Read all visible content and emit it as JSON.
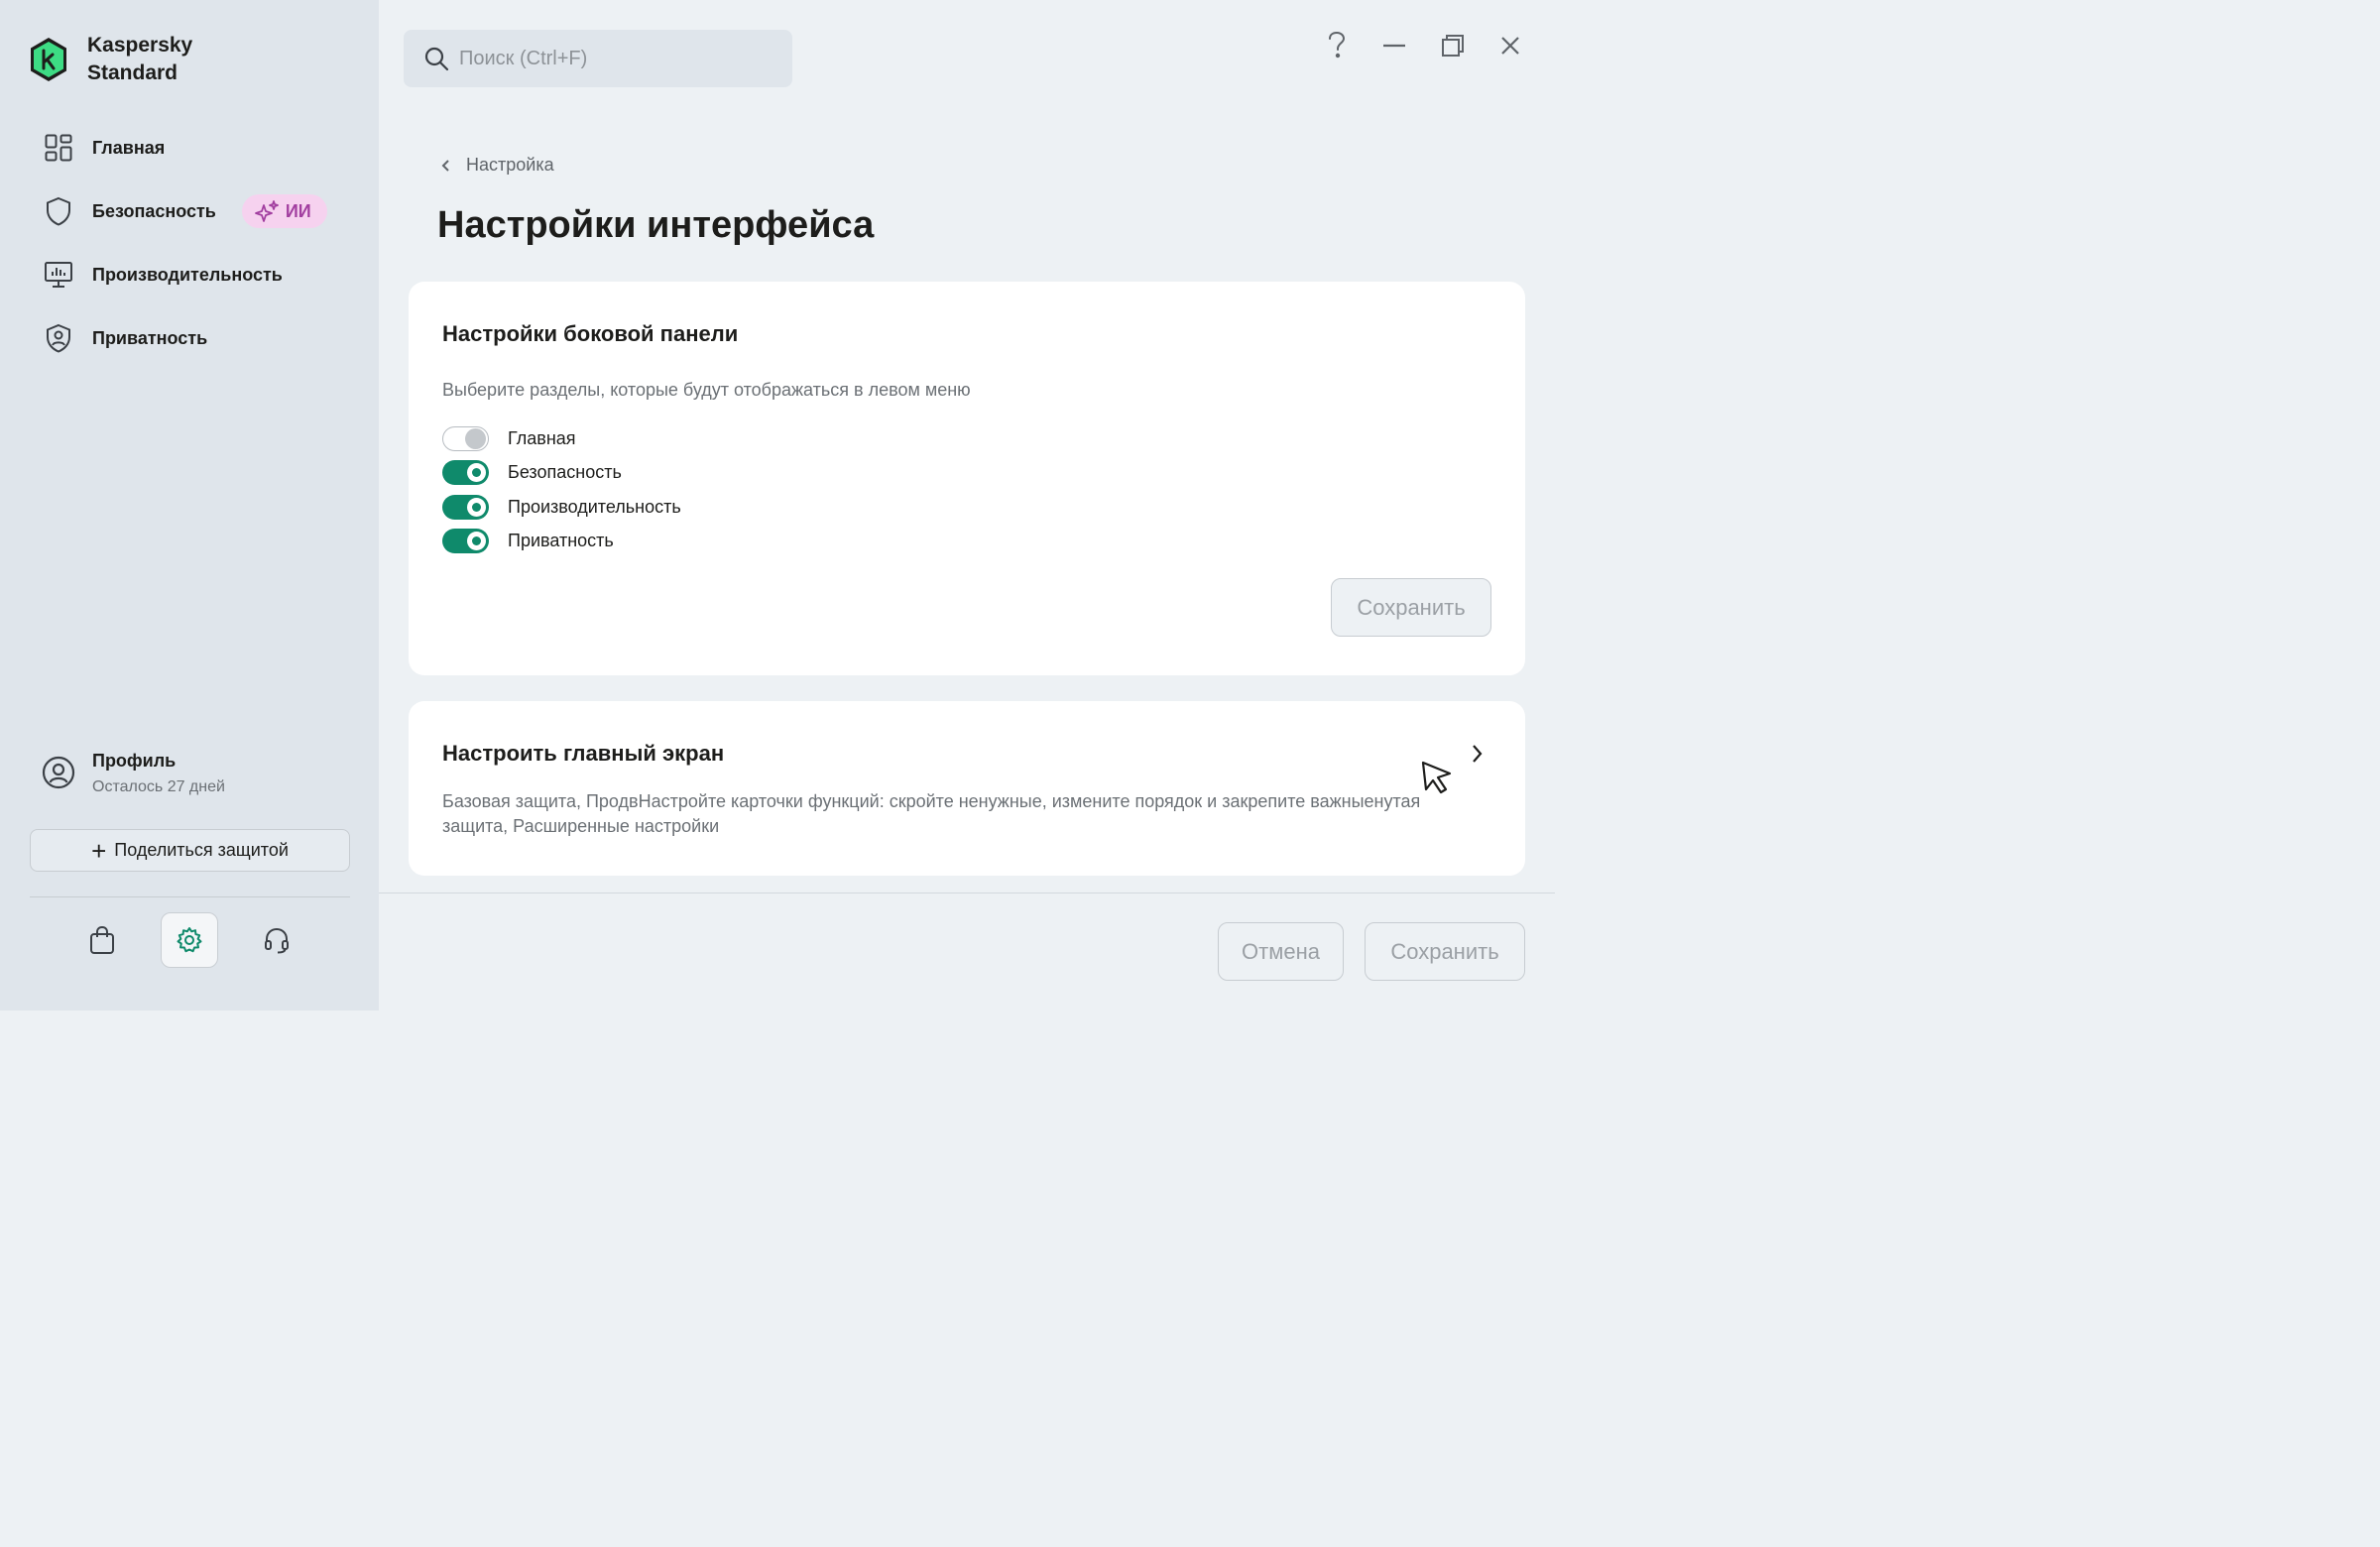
{
  "app": {
    "brand_line1": "Kaspersky",
    "brand_line2": "Standard"
  },
  "sidebar": {
    "items": [
      {
        "label": "Главная",
        "icon": "dashboard-icon"
      },
      {
        "label": "Безопасность",
        "icon": "shield-icon",
        "badge": "ИИ"
      },
      {
        "label": "Производительность",
        "icon": "monitor-chart-icon"
      },
      {
        "label": "Приватность",
        "icon": "privacy-shield-icon"
      }
    ],
    "profile": {
      "name": "Профиль",
      "subtitle": "Осталось 27 дней"
    },
    "share_button": "Поделиться защитой",
    "bottom_icons": [
      "shopping-bag-icon",
      "gear-icon",
      "headset-icon"
    ],
    "active_bottom_icon": "gear-icon"
  },
  "search": {
    "placeholder": "Поиск (Ctrl+F)"
  },
  "window_controls": [
    "help-icon",
    "minimize-icon",
    "restore-icon",
    "close-icon"
  ],
  "breadcrumb": "Настройка",
  "page_title": "Настройки интерфейса",
  "sidebar_settings": {
    "title": "Настройки боковой панели",
    "subtitle": "Выберите разделы, которые будут отображаться в левом меню",
    "toggles": [
      {
        "label": "Главная",
        "on": false
      },
      {
        "label": "Безопасность",
        "on": true
      },
      {
        "label": "Производительность",
        "on": true
      },
      {
        "label": "Приватность",
        "on": true
      }
    ],
    "save_label": "Сохранить"
  },
  "home_screen": {
    "title": "Настроить главный экран",
    "description": "Базовая защита, ПродвНастройте карточки функций: скройте ненужные, измените порядок и закрепите важныенутая защита, Расширенные настройки"
  },
  "footer": {
    "cancel_label": "Отмена",
    "save_label": "Сохранить"
  },
  "colors": {
    "accent": "#0f8a6b",
    "logo_green": "#3ddc84",
    "ai_badge_bg": "#f6d2ef",
    "ai_badge_text": "#a23fa0",
    "sidebar_bg": "#dfe5eb",
    "page_bg": "#edf1f4"
  }
}
